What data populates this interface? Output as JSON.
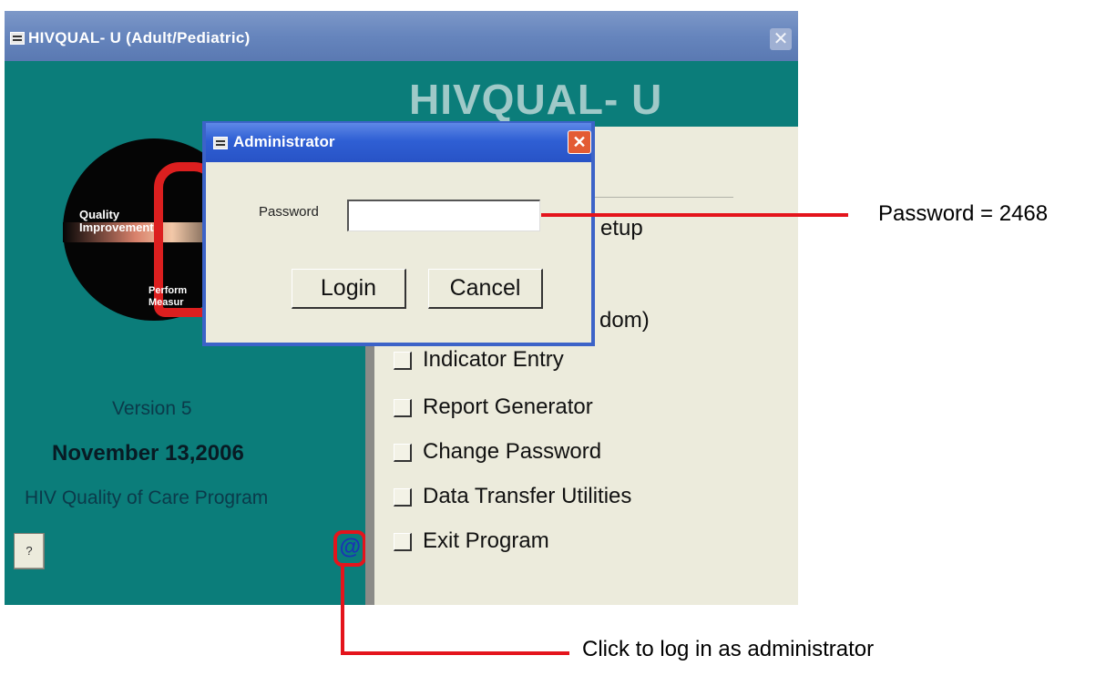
{
  "window": {
    "title": "HIVQUAL- U (Adult/Pediatric)",
    "close": "✕"
  },
  "left": {
    "logo": {
      "line1": "Quality",
      "line2": "Improvement",
      "line3": "Perform",
      "line4": "Measur"
    },
    "version": "Version 5",
    "date": "November 13,2006",
    "program": "HIV Quality of Care Program",
    "help_label": "?",
    "admin_icon": "@"
  },
  "main": {
    "big_title": "HIVQUAL- U",
    "partial_setup": "etup",
    "partial_random": "dom)",
    "menu": [
      {
        "label": "Indicator Entry"
      },
      {
        "label": "Report Generator"
      },
      {
        "label": "Change Password"
      },
      {
        "label": "Data Transfer Utilities"
      },
      {
        "label": "Exit Program"
      }
    ]
  },
  "dialog": {
    "title": "Administrator",
    "close": "✕",
    "password_label": "Password",
    "password_value": "",
    "login_label": "Login",
    "cancel_label": "Cancel"
  },
  "annotations": {
    "password_hint": "Password = 2468",
    "admin_hint": "Click to log in as administrator",
    "line_color": "#e4141c"
  }
}
